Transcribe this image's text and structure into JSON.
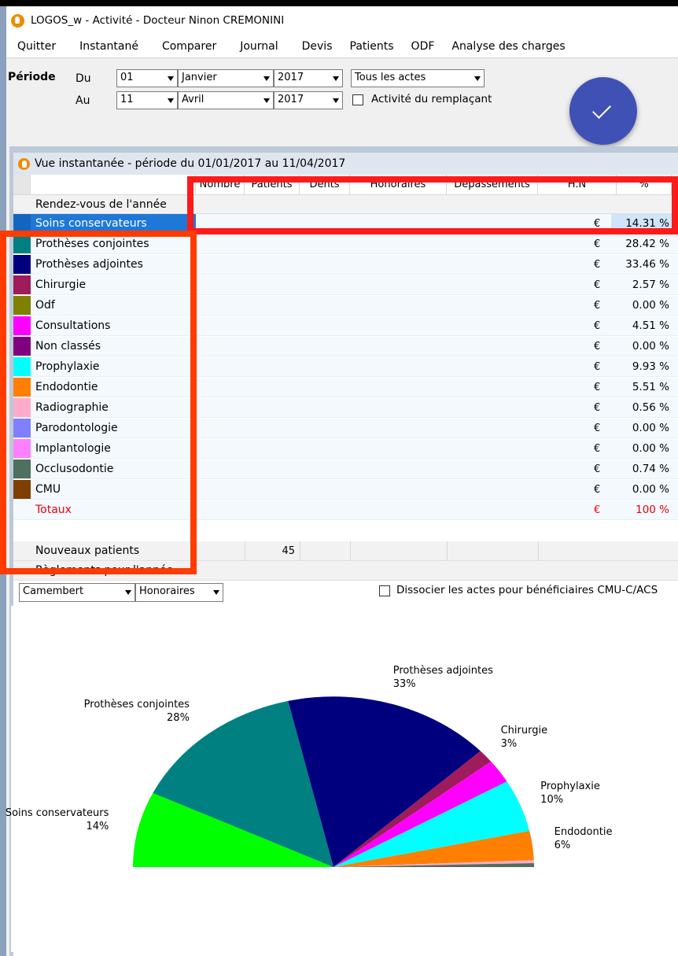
{
  "window": {
    "title": "LOGOS_w - Activité  - Docteur Ninon CREMONINI"
  },
  "menu": [
    "Quitter",
    "Instantané",
    "Comparer",
    "Journal",
    "Devis",
    "Patients",
    "ODF",
    "Analyse des charges"
  ],
  "periode": {
    "label": "Période",
    "du_label": "Du",
    "au_label": "Au",
    "du_day": "01",
    "du_month": "Janvier",
    "du_year": "2017",
    "au_day": "11",
    "au_month": "Avril",
    "au_year": "2017",
    "actes": "Tous les actes",
    "remplacant_label": "Activité du remplaçant"
  },
  "subwindow": {
    "title": "Vue instantanée - période du 01/01/2017 au 11/04/2017"
  },
  "grid": {
    "columns": [
      "Nombre",
      "Patients",
      "Dents",
      "Honoraires",
      "Dépassements",
      "H.N",
      "%"
    ],
    "first_row": "Rendez-vous de l'année",
    "rows": [
      {
        "label": "Soins conservateurs",
        "color": "#1565c0",
        "currency": "€",
        "pct": "14.31 %"
      },
      {
        "label": "Prothèses conjointes",
        "color": "#008080",
        "currency": "€",
        "pct": "28.42 %"
      },
      {
        "label": "Prothèses adjointes",
        "color": "#00007f",
        "currency": "€",
        "pct": "33.46 %"
      },
      {
        "label": "Chirurgie",
        "color": "#9e1b5c",
        "currency": "€",
        "pct": "2.57 %"
      },
      {
        "label": "Odf",
        "color": "#808000",
        "currency": "€",
        "pct": "0.00 %"
      },
      {
        "label": "Consultations",
        "color": "#ff00ff",
        "currency": "€",
        "pct": "4.51 %"
      },
      {
        "label": "Non classés",
        "color": "#800080",
        "currency": "€",
        "pct": "0.00 %"
      },
      {
        "label": "Prophylaxie",
        "color": "#00ffff",
        "currency": "€",
        "pct": "9.93 %"
      },
      {
        "label": "Endodontie",
        "color": "#ff8000",
        "currency": "€",
        "pct": "5.51 %"
      },
      {
        "label": "Radiographie",
        "color": "#ffaac8",
        "currency": "€",
        "pct": "0.56 %"
      },
      {
        "label": "Parodontologie",
        "color": "#8080ff",
        "currency": "€",
        "pct": "0.00 %"
      },
      {
        "label": "Implantologie",
        "color": "#ff80ff",
        "currency": "€",
        "pct": "0.00 %"
      },
      {
        "label": "Occlusodontie",
        "color": "#4f6f5f",
        "currency": "€",
        "pct": "0.74 %"
      },
      {
        "label": "CMU",
        "color": "#7f3f00",
        "currency": "€",
        "pct": "0.00 %"
      }
    ],
    "total": {
      "label": "Totaux",
      "currency": "€",
      "pct": "100 %"
    },
    "new_patients": {
      "label": "Nouveaux patients",
      "patients": "45"
    },
    "reglements": {
      "label": "Règlements pour l'année"
    }
  },
  "chart_controls": {
    "chart_type": "Camembert",
    "measure": "Honoraires",
    "dissocier_label": "Dissocier les actes pour bénéficiaires CMU-C/ACS"
  },
  "colors": {
    "highlight_red": "#ff1a1a",
    "highlight_orange": "#ff3b00",
    "accent_blue": "#3f51b5"
  },
  "chart_data": {
    "type": "pie",
    "shape": "semicircle",
    "slices": [
      {
        "label": "Soins conservateurs",
        "value": 14.31,
        "pct_label": "14%",
        "color": "#00ff00"
      },
      {
        "label": "Prothèses conjointes",
        "value": 28.42,
        "pct_label": "28%",
        "color": "#008080"
      },
      {
        "label": "Prothèses adjointes",
        "value": 33.46,
        "pct_label": "33%",
        "color": "#00007f"
      },
      {
        "label": "Chirurgie",
        "value": 2.57,
        "pct_label": "3%",
        "color": "#9e1b5c"
      },
      {
        "label": "Consultations",
        "value": 4.51,
        "pct_label": "",
        "color": "#ff00ff"
      },
      {
        "label": "Prophylaxie",
        "value": 9.93,
        "pct_label": "10%",
        "color": "#00ffff"
      },
      {
        "label": "Endodontie",
        "value": 5.51,
        "pct_label": "6%",
        "color": "#ff8000"
      },
      {
        "label": "Radiographie",
        "value": 0.56,
        "pct_label": "",
        "color": "#ffaac8"
      },
      {
        "label": "Occlusodontie",
        "value": 0.74,
        "pct_label": "",
        "color": "#4f6f5f"
      }
    ]
  }
}
